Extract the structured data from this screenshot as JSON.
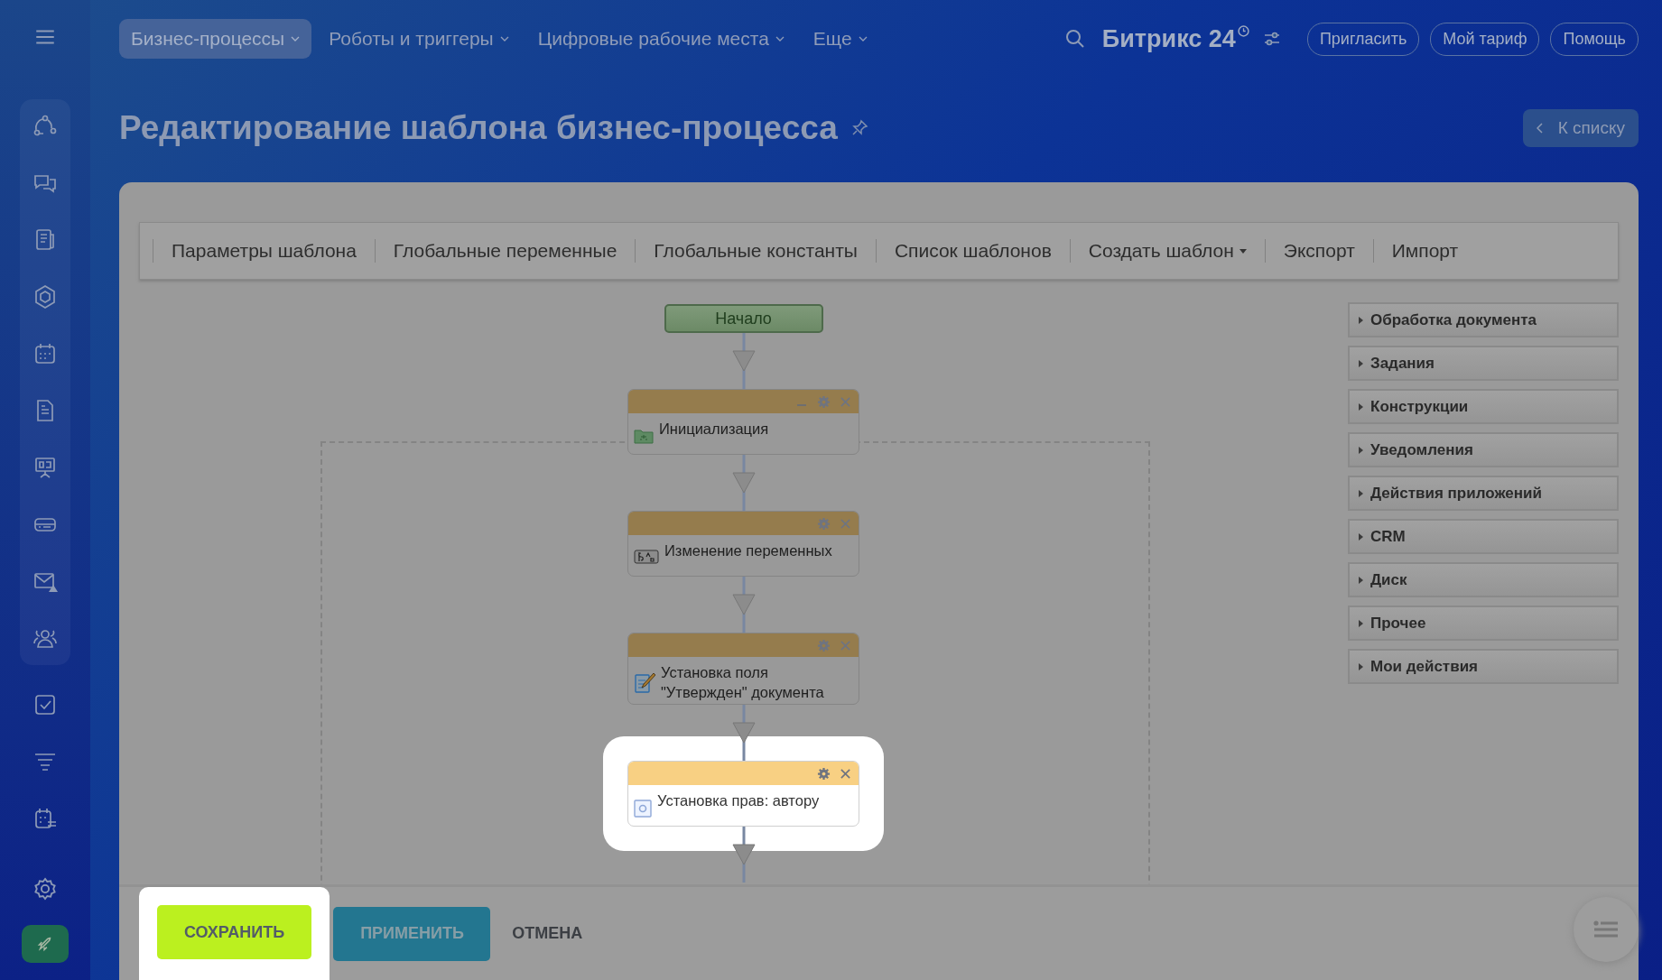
{
  "top_menu": [
    {
      "label": "Бизнес-процессы",
      "selected": true
    },
    {
      "label": "Роботы и триггеры",
      "selected": false
    },
    {
      "label": "Цифровые рабочие места",
      "selected": false
    },
    {
      "label": "Еще",
      "selected": false
    }
  ],
  "logo": "Битрикс 24",
  "header_buttons": [
    "Пригласить",
    "Мой тариф",
    "Помощь"
  ],
  "page_title": "Редактирование шаблона бизнес-процесса",
  "back_button": "К списку",
  "toolbar": [
    {
      "label": "Параметры шаблона",
      "dropdown": false
    },
    {
      "label": "Глобальные переменные",
      "dropdown": false
    },
    {
      "label": "Глобальные константы",
      "dropdown": false
    },
    {
      "label": "Список шаблонов",
      "dropdown": false
    },
    {
      "label": "Создать шаблон",
      "dropdown": true
    },
    {
      "label": "Экспорт",
      "dropdown": false
    },
    {
      "label": "Импорт",
      "dropdown": false
    }
  ],
  "diagram": {
    "start": "Начало",
    "blocks": [
      {
        "title": "Инициализация",
        "kind": "folder",
        "collapsible": true,
        "highlighted": false
      },
      {
        "title": "Изменение переменных",
        "kind": "variables",
        "collapsible": false,
        "highlighted": false
      },
      {
        "title": "Установка поля \"Утвержден\" документа",
        "kind": "edit",
        "collapsible": false,
        "highlighted": false
      },
      {
        "title": "Установка прав: автору",
        "kind": "permissions",
        "collapsible": false,
        "highlighted": true
      }
    ]
  },
  "palette": [
    "Обработка документа",
    "Задания",
    "Конструкции",
    "Уведомления",
    "Действия приложений",
    "CRM",
    "Диск",
    "Прочее",
    "Мои действия"
  ],
  "footer": [
    {
      "label": "СОХРАНИТЬ",
      "kind": "save",
      "highlighted": true
    },
    {
      "label": "ПРИМЕНИТЬ",
      "kind": "apply",
      "highlighted": false
    },
    {
      "label": "ОТМЕНА",
      "kind": "cancel",
      "highlighted": false
    }
  ]
}
